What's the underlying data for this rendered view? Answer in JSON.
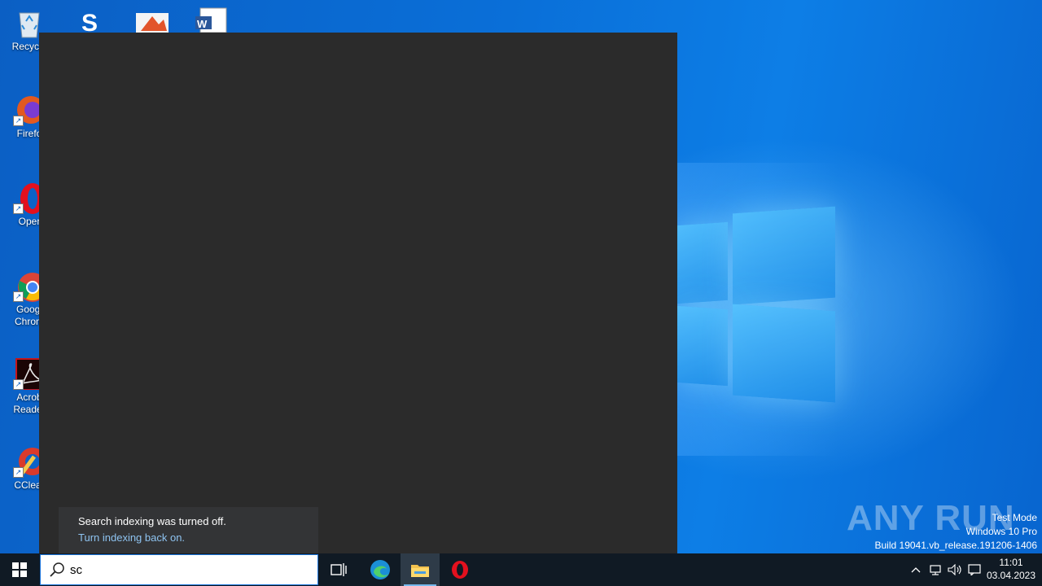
{
  "desktop": {
    "icons": [
      {
        "label": "Recycle",
        "label2": ""
      },
      {
        "label": "Firefo",
        "label2": ""
      },
      {
        "label": "Oper",
        "label2": ""
      },
      {
        "label": "Googl",
        "label2": "Chrom"
      },
      {
        "label": "Acrob",
        "label2": "Reader"
      },
      {
        "label": "CClear",
        "label2": ""
      }
    ]
  },
  "search_panel": {
    "notice_title": "Search indexing was turned off.",
    "notice_link": "Turn indexing back on."
  },
  "taskbar": {
    "search_value": "sc",
    "clock_time": "11:01",
    "clock_date": "03.04.2023"
  },
  "watermark": {
    "brand": "ANY RUN",
    "line1": "Test Mode",
    "line2": "Windows 10 Pro",
    "line3": "Build 19041.vb_release.191206-1406"
  },
  "colors": {
    "panel_bg": "#2b2b2b",
    "notice_bg": "#333436",
    "link": "#8ec3f0",
    "taskbar_bg": "#101a24",
    "accent": "#1a73d9"
  }
}
